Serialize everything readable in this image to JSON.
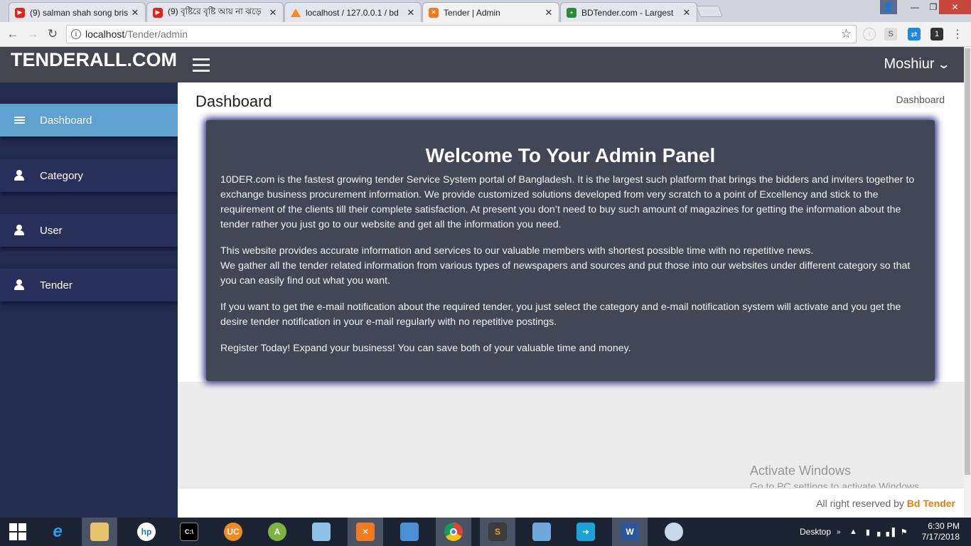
{
  "browser": {
    "tabs": [
      {
        "title": "(9) salman shah song bris",
        "favicon": "youtube-icon"
      },
      {
        "title": "(9) বৃষ্টিরে বৃষ্টি আয় না ঝড়ে",
        "favicon": "youtube-icon"
      },
      {
        "title": "localhost / 127.0.0.1 / bd",
        "favicon": "phpmyadmin-icon"
      },
      {
        "title": "Tender | Admin",
        "favicon": "xampp-icon"
      },
      {
        "title": "BDTender.com - Largest",
        "favicon": "bdtender-icon"
      }
    ],
    "url_host": "localhost",
    "url_path": "/Tender/admin"
  },
  "header": {
    "brand": "TENDERALL.COM",
    "user_name": "Moshiur"
  },
  "sidebar": {
    "items": [
      {
        "label": "Dashboard",
        "icon": "bars-icon",
        "active": true
      },
      {
        "label": "Category",
        "icon": "user-icon",
        "active": false
      },
      {
        "label": "User",
        "icon": "user-icon",
        "active": false
      },
      {
        "label": "Tender",
        "icon": "user-icon",
        "active": false
      }
    ]
  },
  "main": {
    "page_title": "Dashboard",
    "breadcrumb": "Dashboard",
    "panel": {
      "heading": "Welcome To Your Admin Panel",
      "p1": "10DER.com is the fastest growing tender Service System portal of Bangladesh. It is the largest such platform that brings the bidders and inviters together to exchange business procurement information. We provide customized solutions developed from very scratch to a point of Excellency and stick to the requirement of the clients till their complete satisfaction. At present you don’t need to buy such amount of magazines for getting the information about the tender rather you just go to our website and get all the information you need.",
      "p2a": "This website provides accurate information and services to our valuable members with shortest possible time with no repetitive news.",
      "p2b": "We gather all the tender related information from various types of newspapers and sources and put those into our websites under different category so that you can easily find out what you want.",
      "p3": "If you want to get the e-mail notification about the required tender, you just select the category and e-mail notification system will activate and you get the desire tender notification in your e-mail regularly with no repetitive postings.",
      "p4": "Register Today! Expand your business! You can save both of your valuable time and money."
    },
    "footer_prefix": "All right reserved by",
    "footer_brand": "Bd Tender"
  },
  "watermark": {
    "line1": "Activate Windows",
    "line2": "Go to PC settings to activate Windows."
  },
  "taskbar": {
    "desktop_label": "Desktop",
    "time": "6:30 PM",
    "date": "7/17/2018"
  },
  "colors": {
    "sidebar_bg": "#232c4e",
    "sidebar_active": "#5fa2cf",
    "header_bg": "#44454f",
    "panel_bg": "#424756",
    "footer_brand": "#e07f10"
  }
}
